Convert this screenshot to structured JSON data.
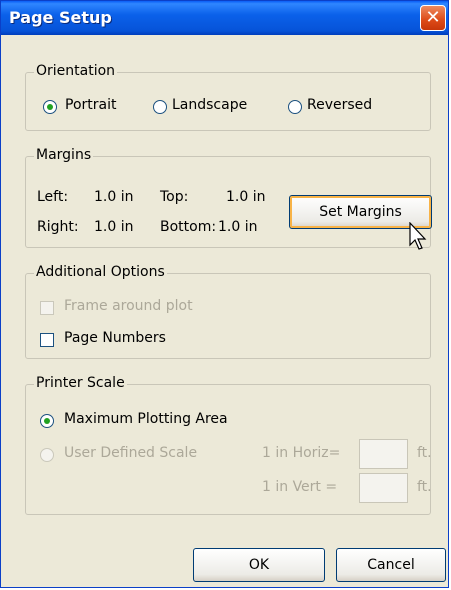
{
  "window": {
    "title": "Page Setup",
    "close_glyph": "✕"
  },
  "orientation": {
    "legend": "Orientation",
    "options": [
      {
        "label": "Portrait",
        "selected": true
      },
      {
        "label": "Landscape",
        "selected": false
      },
      {
        "label": "Reversed",
        "selected": false
      }
    ]
  },
  "margins": {
    "legend": "Margins",
    "left_label": "Left:",
    "left_value": "1.0 in",
    "top_label": "Top:",
    "top_value": "1.0 in",
    "right_label": "Right:",
    "right_value": "1.0 in",
    "bottom_label": "Bottom:",
    "bottom_value": "1.0 in",
    "set_button": "Set Margins"
  },
  "additional": {
    "legend": "Additional Options",
    "frame_label": "Frame around plot",
    "frame_checked": false,
    "frame_enabled": false,
    "page_numbers_label": "Page Numbers",
    "page_numbers_checked": false
  },
  "printer_scale": {
    "legend": "Printer Scale",
    "max_area_label": "Maximum Plotting Area",
    "max_area_selected": true,
    "user_defined_label": "User Defined Scale",
    "user_defined_enabled": false,
    "horiz_label": "1 in Horiz=",
    "vert_label": "1 in Vert =",
    "unit": "ft.",
    "horiz_value": "",
    "vert_value": ""
  },
  "buttons": {
    "ok": "OK",
    "cancel": "Cancel"
  }
}
